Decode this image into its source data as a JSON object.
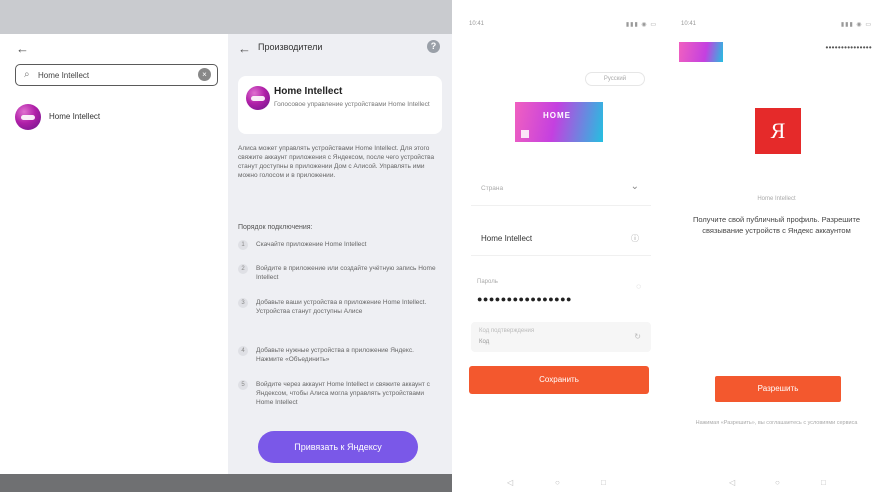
{
  "screen1": {
    "search": {
      "value": "Home Intellect"
    },
    "result": {
      "label": "Home Intellect"
    }
  },
  "screen2": {
    "header": {
      "title": "Производители"
    },
    "card": {
      "name": "Home Intellect",
      "description": "Голосовое управление устройствами Home Intellect"
    },
    "intro": "Алиса может управлять устройствами Home Intellect. Для этого свяжите аккаунт приложения с Яндексом, после чего устройства станут доступны в приложении Дом с Алисой. Управлять ими можно голосом и в приложении.",
    "steps_title": "Порядок подключения:",
    "steps": [
      {
        "num": "1",
        "text": "Скачайте приложение Home Intellect"
      },
      {
        "num": "2",
        "text": "Войдите в приложение или создайте учётную запись Home Intellect"
      },
      {
        "num": "3",
        "text": "Добавьте ваши устройства в приложение Home Intellect. Устройства станут доступны Алисе"
      },
      {
        "num": "4",
        "text": "Добавьте нужные устройства в приложение Яндекс. Нажмите «Объединить»"
      },
      {
        "num": "5",
        "text": "Войдите через аккаунт Home Intellect и свяжите аккаунт с Яндексом, чтобы Алиса могла управлять устройствами Home Intellect"
      }
    ],
    "connect_button": "Привязать к Яндексу"
  },
  "screen3": {
    "status": {
      "time": "10:41",
      "signal": "▮▮▮ ◉ ▭"
    },
    "language": "Русский",
    "banner_text": "HOME",
    "country": {
      "placeholder": "Страна"
    },
    "account": {
      "value": "Home Intellect"
    },
    "password": {
      "label": "Пароль",
      "value": "●●●●●●●●●●●●●●●●"
    },
    "code": {
      "label": "Код подтверждения",
      "value": "Код"
    },
    "save_button": "Сохранить"
  },
  "screen4": {
    "status": {
      "time": "10:41",
      "signal": "▮▮▮ ◉ ▭"
    },
    "password_mask": "•••••••••••••••",
    "yandex_letter": "Я",
    "small_text": "Home Intellect",
    "main_text": "Получите свой публичный профиль. Разрешите связывание устройств с Яндекс аккаунтом",
    "allow_button": "Разрешить",
    "legal": "Нажимая «Разрешить», вы соглашаетесь с условиями сервиса"
  },
  "nav": {
    "back": "◁",
    "home": "○",
    "recent": "□"
  },
  "colors": {
    "accent_purple": "#7a58e8",
    "accent_orange": "#f3582e",
    "yandex_red": "#e52a2a",
    "panel_gray": "#eeeff3"
  },
  "icons": [
    "back-icon",
    "search-icon",
    "clear-icon",
    "help-icon",
    "chevron-down-icon",
    "eye-icon",
    "yandex-logo"
  ]
}
